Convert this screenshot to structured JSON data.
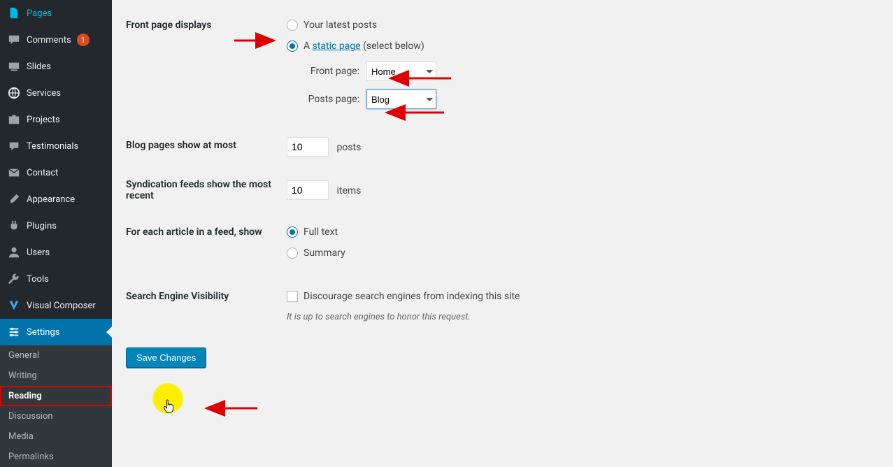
{
  "sidebar": {
    "menu": [
      {
        "id": "pages",
        "label": "Pages"
      },
      {
        "id": "comments",
        "label": "Comments",
        "badge": "1"
      },
      {
        "id": "slides",
        "label": "Slides"
      },
      {
        "id": "services",
        "label": "Services"
      },
      {
        "id": "projects",
        "label": "Projects"
      },
      {
        "id": "testimonials",
        "label": "Testimonials"
      },
      {
        "id": "contact",
        "label": "Contact"
      }
    ],
    "menu2": [
      {
        "id": "appearance",
        "label": "Appearance"
      },
      {
        "id": "plugins",
        "label": "Plugins"
      },
      {
        "id": "users",
        "label": "Users"
      },
      {
        "id": "tools",
        "label": "Tools"
      },
      {
        "id": "vcomposer",
        "label": "Visual Composer"
      },
      {
        "id": "settings",
        "label": "Settings",
        "current": true
      }
    ],
    "submenu": [
      {
        "id": "general",
        "label": "General"
      },
      {
        "id": "writing",
        "label": "Writing"
      },
      {
        "id": "reading",
        "label": "Reading",
        "current": true,
        "highlighted": true
      },
      {
        "id": "discussion",
        "label": "Discussion"
      },
      {
        "id": "media",
        "label": "Media"
      },
      {
        "id": "permalinks",
        "label": "Permalinks"
      }
    ]
  },
  "labels": {
    "front_page_displays": "Front page displays",
    "opt_latest_posts": "Your latest posts",
    "opt_static_prefix": "A ",
    "opt_static_link": "static page",
    "opt_static_suffix": " (select below)",
    "front_page": "Front page:",
    "posts_page": "Posts page:",
    "blog_pages_show": "Blog pages show at most",
    "posts_suffix": "posts",
    "syndication": "Syndication feeds show the most recent",
    "items_suffix": "items",
    "feed_article": "For each article in a feed, show",
    "full_text": "Full text",
    "summary": "Summary",
    "sev": "Search Engine Visibility",
    "discourage": "Discourage search engines from indexing this site",
    "sev_desc": "It is up to search engines to honor this request.",
    "save": "Save Changes"
  },
  "values": {
    "front_page_mode": "static",
    "front_page_select": "Home",
    "posts_page_select": "Blog",
    "blog_pages_count": "10",
    "syndication_count": "10",
    "feed_mode": "full",
    "discourage_checked": false
  }
}
